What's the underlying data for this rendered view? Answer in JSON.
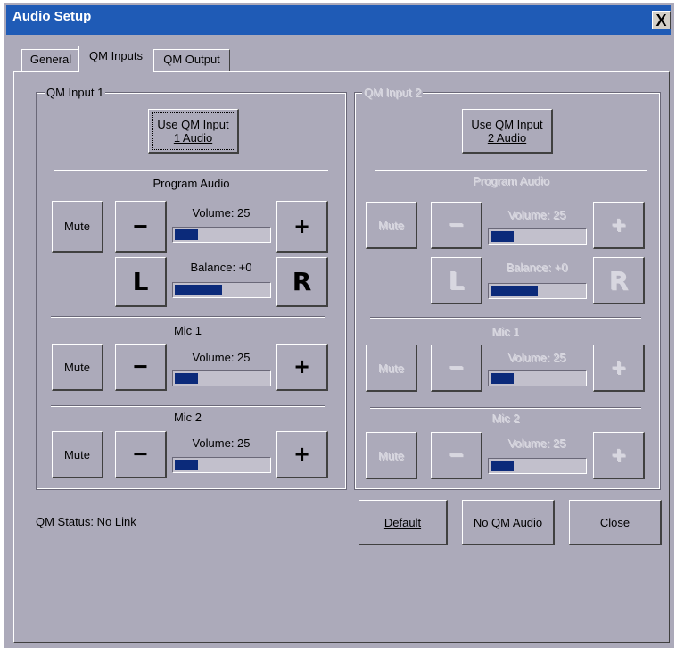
{
  "window": {
    "title": "Audio Setup",
    "close_glyph": "X"
  },
  "tabs": [
    {
      "label": "General"
    },
    {
      "label": "QM Inputs"
    },
    {
      "label": "QM Output"
    }
  ],
  "input1": {
    "legend": "QM Input 1",
    "use_button": {
      "line1": "Use QM Input",
      "line2": "1 Audio"
    },
    "program": {
      "title": "Program Audio",
      "mute": "Mute",
      "minus": "−",
      "plus": "+",
      "volume_label": "Volume: 25",
      "volume_fraction": 0.25,
      "balance_label": "Balance: +0",
      "balance_fraction": 0.5,
      "left": "L",
      "right": "R"
    },
    "mic1": {
      "title": "Mic 1",
      "mute": "Mute",
      "minus": "−",
      "plus": "+",
      "volume_label": "Volume: 25",
      "volume_fraction": 0.25
    },
    "mic2": {
      "title": "Mic 2",
      "mute": "Mute",
      "minus": "−",
      "plus": "+",
      "volume_label": "Volume: 25",
      "volume_fraction": 0.25
    }
  },
  "input2": {
    "legend": "QM Input 2",
    "use_button": {
      "line1": "Use QM Input",
      "line2": "2 Audio"
    },
    "program": {
      "title": "Program Audio",
      "mute": "Mute",
      "minus": "−",
      "plus": "+",
      "volume_label": "Volume: 25",
      "volume_fraction": 0.25,
      "balance_label": "Balance: +0",
      "balance_fraction": 0.5,
      "left": "L",
      "right": "R"
    },
    "mic1": {
      "title": "Mic 1",
      "mute": "Mute",
      "minus": "−",
      "plus": "+",
      "volume_label": "Volume: 25",
      "volume_fraction": 0.25
    },
    "mic2": {
      "title": "Mic 2",
      "mute": "Mute",
      "minus": "−",
      "plus": "+",
      "volume_label": "Volume: 25",
      "volume_fraction": 0.25
    }
  },
  "status": "QM Status: No Link",
  "buttons": {
    "default": "Default",
    "no_qm_audio": "No QM Audio",
    "close": "Close"
  },
  "colors": {
    "titlebar": "#1f5bb6",
    "face": "#acaaba",
    "meter_fill": "#0b2a7a"
  }
}
